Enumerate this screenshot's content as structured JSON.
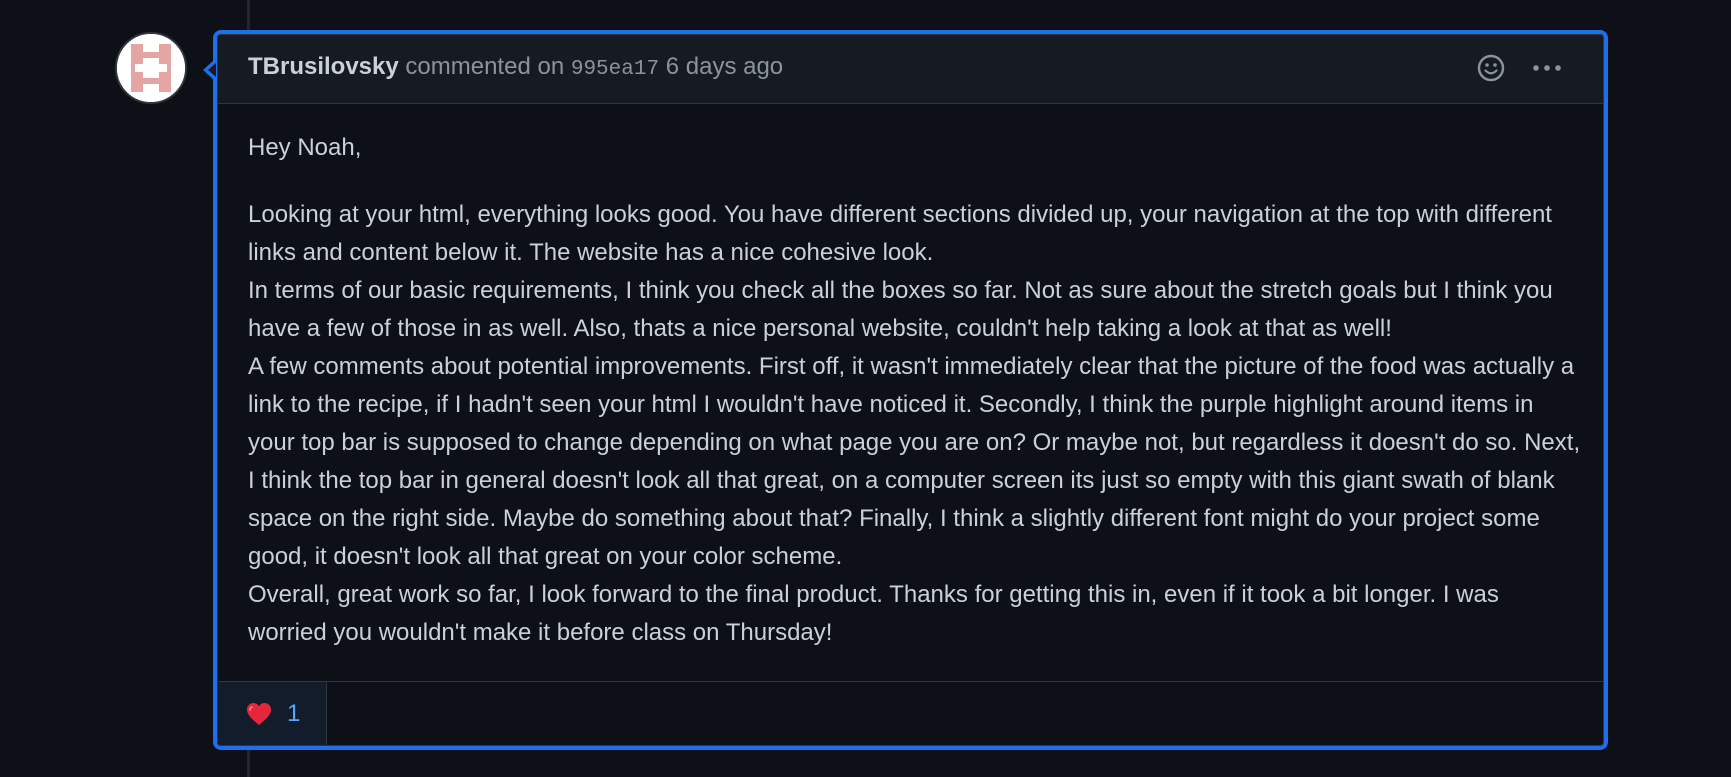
{
  "comment": {
    "author": "TBrusilovsky",
    "action_text": "commented on",
    "commit_sha": "995ea17",
    "timestamp": "6 days ago",
    "avatar_icon": "identicon-avatar",
    "body": {
      "greeting": "Hey Noah,",
      "paragraphs": [
        "Looking at your html, everything looks good. You have different sections divided up, your navigation at the top with different links and content below it. The website has a nice cohesive look.",
        "In terms of our basic requirements, I think you check all the boxes so far. Not as sure about the stretch goals but I think you have a few of those in as well. Also, thats a nice personal website, couldn't help taking a look at that as well!",
        "A few comments about potential improvements. First off, it wasn't immediately clear that the picture of the food was actually a link to the recipe, if I hadn't seen your html I wouldn't have noticed it. Secondly, I think the purple highlight around items in your top bar is supposed to change depending on what page you are on? Or maybe not, but regardless it doesn't do so. Next, I think the top bar in general doesn't look all that great, on a computer screen its just so empty with this giant swath of blank space on the right side. Maybe do something about that? Finally, I think a slightly different font might do your project some good, it doesn't look all that great on your color scheme.",
        "Overall, great work so far, I look forward to the final product. Thanks for getting this in, even if it took a bit longer. I was worried you wouldn't make it before class on Thursday!"
      ]
    },
    "reactions": [
      {
        "emoji": "❤️",
        "icon": "heart-icon",
        "count": "1"
      }
    ],
    "header_icons": [
      "smiley-icon",
      "kebab-menu-icon"
    ]
  },
  "colors": {
    "background": "#0d1117",
    "header_bg": "#161b22",
    "highlight_border": "#1f6feb",
    "text": "#c9d1d9",
    "muted_text": "#8b949e",
    "reaction_count": "#58a6ff",
    "heart": "#e5263b",
    "avatar_pink": "#e4a4a4"
  }
}
